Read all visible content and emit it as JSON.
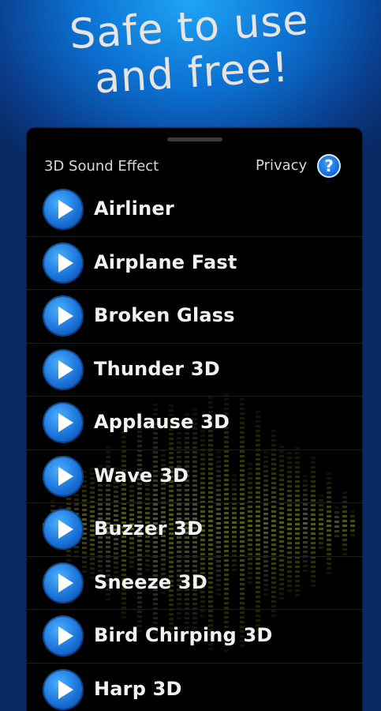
{
  "headline": {
    "line1": "Safe to use",
    "line2": "and free!"
  },
  "app": {
    "title": "3D Sound Effect",
    "privacy_label": "Privacy",
    "help_glyph": "?"
  },
  "sounds": [
    {
      "label": "Airliner",
      "icon": "play-icon"
    },
    {
      "label": "Airplane Fast",
      "icon": "play-icon"
    },
    {
      "label": "Broken Glass",
      "icon": "play-icon"
    },
    {
      "label": "Thunder 3D",
      "icon": "play-icon"
    },
    {
      "label": "Applause 3D",
      "icon": "play-icon"
    },
    {
      "label": "Wave 3D",
      "icon": "play-icon"
    },
    {
      "label": "Buzzer 3D",
      "icon": "play-icon"
    },
    {
      "label": "Sneeze 3D",
      "icon": "play-icon"
    },
    {
      "label": "Bird Chirping 3D",
      "icon": "play-icon"
    },
    {
      "label": "Harp 3D",
      "icon": "play-icon"
    }
  ],
  "colors": {
    "background_blue": "#0b6fd0",
    "panel": "#000000",
    "accent_button": "#1a72d9",
    "visualizer": "#b8c23a"
  }
}
